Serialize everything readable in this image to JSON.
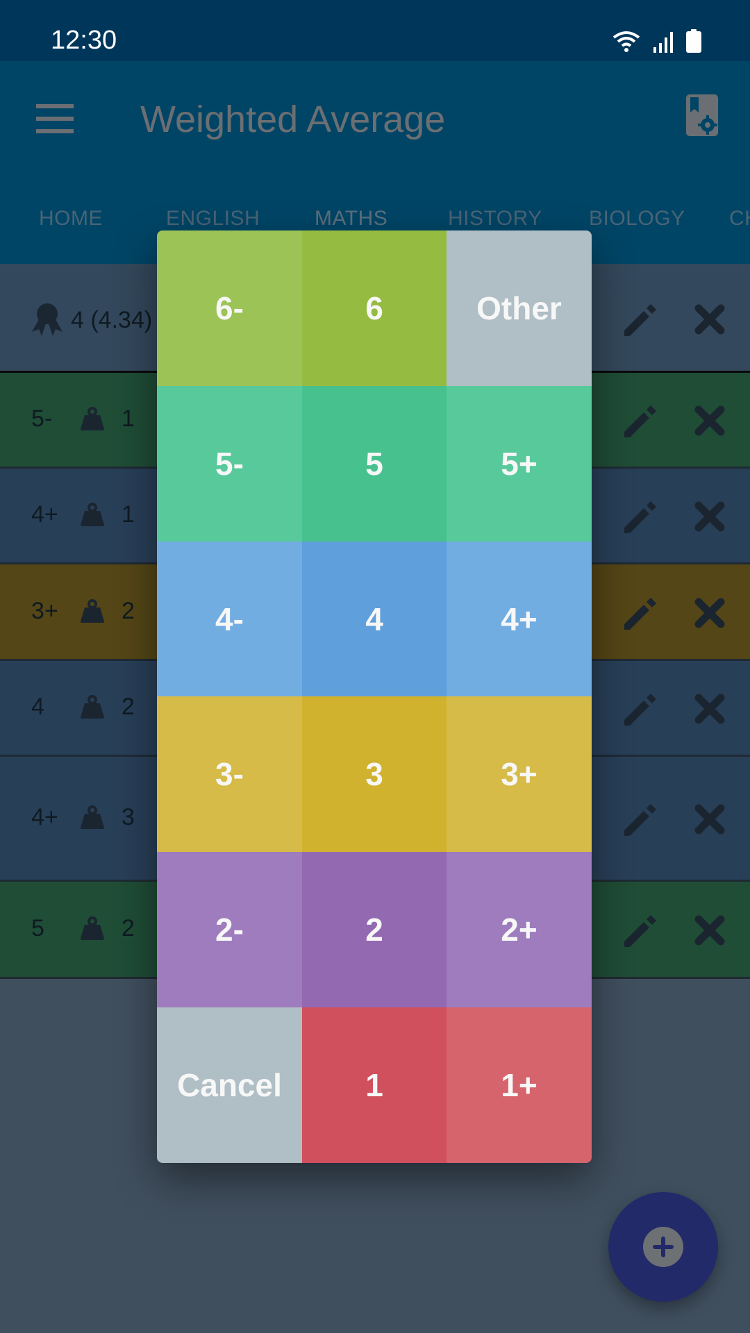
{
  "status_bar": {
    "time": "12:30",
    "icons": [
      "wifi-icon",
      "signal-icon",
      "battery-icon"
    ]
  },
  "app_bar": {
    "title": "Weighted Average",
    "menu_icon": "menu-icon",
    "settings_icon": "subject-settings-icon"
  },
  "tabs": [
    {
      "label": "HOME",
      "active": false
    },
    {
      "label": "ENGLISH",
      "active": false
    },
    {
      "label": "MATHS",
      "active": true
    },
    {
      "label": "HISTORY",
      "active": false
    },
    {
      "label": "BIOLOGY",
      "active": false
    },
    {
      "label": "CH",
      "active": false
    }
  ],
  "average": {
    "value": "4 (4.34)",
    "icon": "award-icon"
  },
  "grades": [
    {
      "grade": "5-",
      "weight": "1",
      "color": "#1f4d36"
    },
    {
      "grade": "4+",
      "weight": "1",
      "color": "#283f58"
    },
    {
      "grade": "3+",
      "weight": "2",
      "color": "#544616"
    },
    {
      "grade": "4",
      "weight": "2",
      "color": "#283f58"
    },
    {
      "grade": "4+",
      "weight": "3",
      "color": "#283f58"
    },
    {
      "grade": "5",
      "weight": "2",
      "color": "#1f4d36"
    }
  ],
  "grade_picker": {
    "cells": [
      {
        "label": "6-",
        "color": "#9cc356"
      },
      {
        "label": "6",
        "color": "#95bb41"
      },
      {
        "label": "Other",
        "color": "#b0bec5"
      },
      {
        "label": "5-",
        "color": "#58c99b"
      },
      {
        "label": "5",
        "color": "#47c28f"
      },
      {
        "label": "5+",
        "color": "#58c99b"
      },
      {
        "label": "4-",
        "color": "#72ade2"
      },
      {
        "label": "4",
        "color": "#5f9fdc"
      },
      {
        "label": "4+",
        "color": "#72ade2"
      },
      {
        "label": "3-",
        "color": "#d7bb48"
      },
      {
        "label": "3",
        "color": "#d1b22f"
      },
      {
        "label": "3+",
        "color": "#d7bb48"
      },
      {
        "label": "2-",
        "color": "#9e7cbd"
      },
      {
        "label": "2",
        "color": "#9369b1"
      },
      {
        "label": "2+",
        "color": "#9e7cbd"
      },
      {
        "label": "Cancel",
        "color": "#b0bec5"
      },
      {
        "label": "1",
        "color": "#d0505e"
      },
      {
        "label": "1+",
        "color": "#d6646d"
      }
    ]
  },
  "fab": {
    "icon": "add-icon"
  }
}
